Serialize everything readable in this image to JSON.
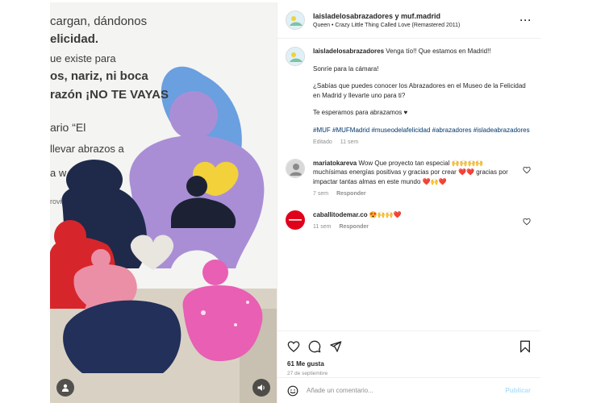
{
  "header": {
    "title": "laisladelosabrazadores y muf.madrid",
    "audio": "Queen • Crazy Little Thing Called Love (Remastered 2011)",
    "more_icon": "more-horizontal-icon"
  },
  "media": {
    "wall_lines": [
      "cargan, dándonos",
      "elicidad.",
      "ue existe para",
      "os, nariz, ni boca",
      "razón ¡NO TE VAYAS",
      "ario “El",
      "llevar abrazos a",
      "a w",
      "rovidin"
    ],
    "user_icon": "user-tag-icon",
    "sound_icon": "speaker-icon",
    "colors": {
      "purple": "#a98ed6",
      "navy": "#1f2a4a",
      "red": "#d7262b",
      "pink": "#ea8fa6",
      "galaxy": "#e85fb4",
      "yellow": "#f2d13b",
      "wall_blue": "#6a9fe0"
    }
  },
  "caption": {
    "username": "laisladelosabrazadores",
    "lines": [
      "Venga tío!! Que estamos en Madrid!!",
      "Sonríe para la cámara!",
      "¿Sabías que puedes conocer los Abrazadores en el Museo de la Felicidad en Madrid y llevarte uno para ti?",
      "Te esperamos para abrazamos ♥"
    ],
    "hashtags": "#MUF #MUFMadrid #museodelafelicidad #abrazadores #isladeabrazadores",
    "edited": "Editado",
    "time": "11 sem"
  },
  "comments": [
    {
      "username": "mariatokareva",
      "text": "Wow Que proyecto tan especial 🙌🙌🙌🙌 muchísimas energías positivas y gracias por crear ❤️❤️ gracias por impactar tantas almas en este mundo ❤️🙌❤️",
      "time": "7 sem",
      "reply": "Responder"
    },
    {
      "username": "caballitodemar.co",
      "text": "😍🙌🙌❤️",
      "time": "11 sem",
      "reply": "Responder"
    }
  ],
  "stats": {
    "likes": "61 Me gusta",
    "date": "27 de septiembre"
  },
  "composer": {
    "placeholder": "Añade un comentario...",
    "publish": "Publicar"
  }
}
